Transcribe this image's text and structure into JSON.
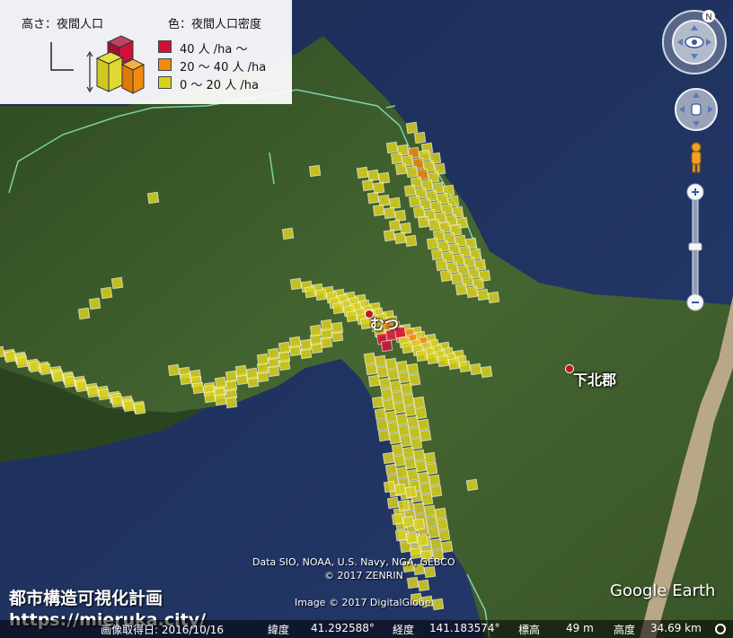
{
  "legend": {
    "height_label": "高さ：夜間人口",
    "color_label": "色：夜間人口密度",
    "classes": [
      {
        "label": "40 人 /ha ～",
        "color": "#d0103a"
      },
      {
        "label": "20 ～ 40 人 /ha",
        "color": "#f08a10"
      },
      {
        "label": "0 ～ 20 人 /ha",
        "color": "#d8d020"
      }
    ]
  },
  "places": [
    {
      "name": "むつ"
    },
    {
      "name": "下北郡"
    }
  ],
  "attribution": {
    "line1": "Data SIO, NOAA, U.S. Navy, NGA, GEBCO",
    "line2": "© 2017 ZENRIN",
    "imagery": "Image © 2017 DigitalGlobe"
  },
  "brand": {
    "title": "都市構造可視化計画",
    "url": "https://mieruka.city/"
  },
  "logo": "Google Earth",
  "status_bar": {
    "imagery_date": "画像取得日: 2016/10/16",
    "lat_label": "緯度",
    "lat_value": "41.292588°",
    "lon_label": "経度",
    "lon_value": "141.183574°",
    "elev_label": "標高",
    "elev_value": "49 m",
    "alt_label": "高度",
    "alt_value": "34.69 km"
  },
  "colors": {
    "sea": "#1f3260",
    "land": "#3d5a2a",
    "boundary": "#8ff0d0",
    "high": "#d0103a",
    "mid": "#f08a10",
    "low": "#d8d020"
  },
  "nav_controls": {
    "compass_icon": "compass-icon",
    "look_icon": "eye-icon",
    "move_icon": "hand-icon",
    "pegman_icon": "pegman-icon",
    "zoom_in_icon": "plus-icon",
    "zoom_out_icon": "minus-icon"
  },
  "compass_north": "N"
}
